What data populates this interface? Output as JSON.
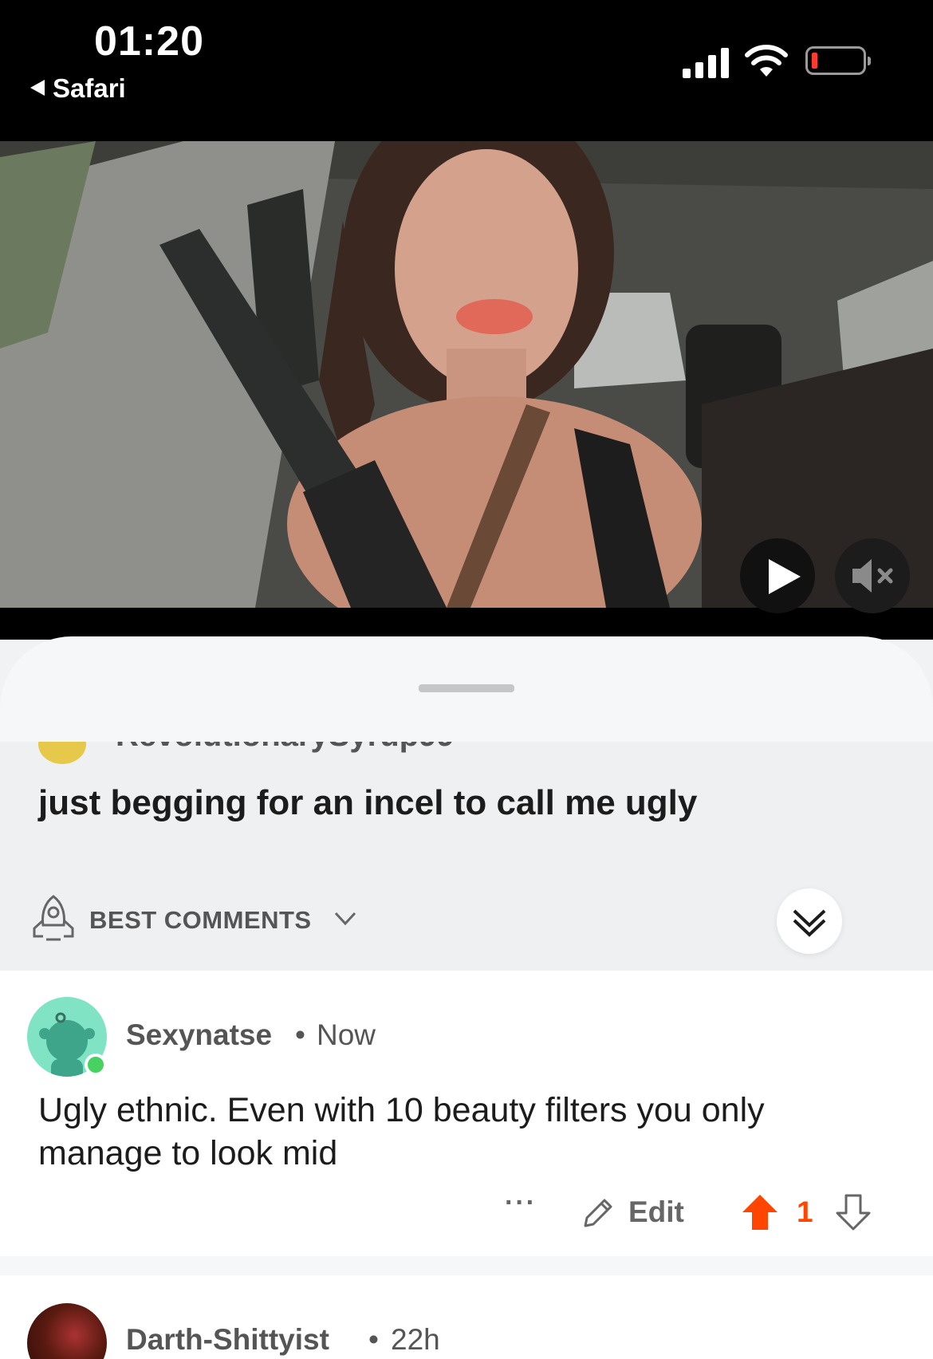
{
  "status_bar": {
    "time": "01:20",
    "back_label": "Safari"
  },
  "post": {
    "author": "RevolutionarySyrup99",
    "title": "just begging for an incel to call me ugly"
  },
  "sort": {
    "label": "BEST COMMENTS"
  },
  "comments": [
    {
      "author": "Sexynatse",
      "separator": "•",
      "time": "Now",
      "body": "Ugly ethnic. Even with 10 beauty filters you only manage to look mid",
      "more": "···",
      "edit_label": "Edit",
      "score": "1"
    },
    {
      "author": "Darth-Shittyist",
      "separator": "•",
      "time": "22h"
    }
  ],
  "colors": {
    "upvote": "#ff4500",
    "online": "#46d160",
    "avatar_bg": "#7fe3c4"
  }
}
